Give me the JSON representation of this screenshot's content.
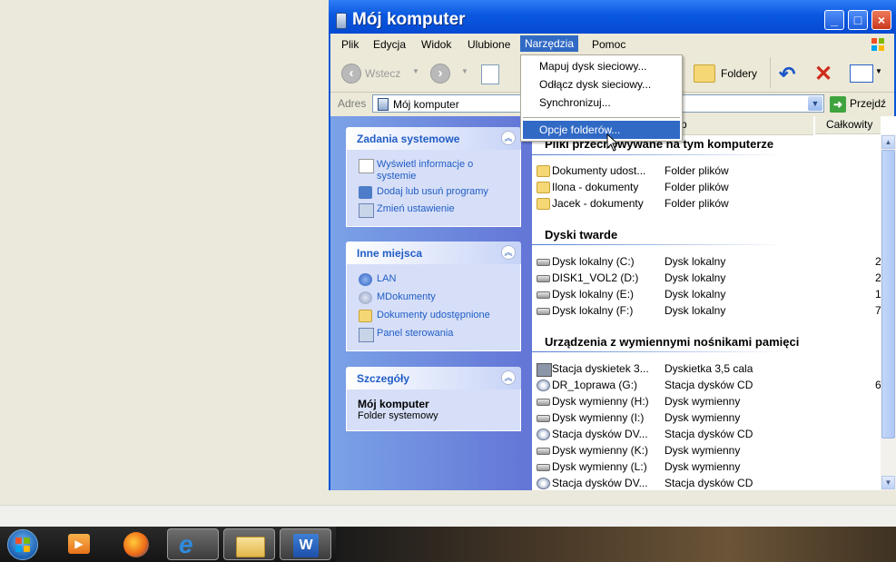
{
  "window": {
    "title": "Mój komputer",
    "min": "_",
    "max": "□",
    "close": "×"
  },
  "menu": [
    "Plik",
    "Edycja",
    "Widok",
    "Ulubione",
    "Narzędzia",
    "Pomoc"
  ],
  "toolbar": {
    "back": "Wstecz",
    "folders": "Foldery"
  },
  "address": {
    "label": "Adres",
    "value": "Mój komputer",
    "go": "Przejdź"
  },
  "dropdown": {
    "items": [
      "Mapuj dysk sieciowy...",
      "Odłącz dysk sieciowy...",
      "Synchronizuj...",
      "Opcje folderów..."
    ]
  },
  "tasks": {
    "system": {
      "title": "Zadania systemowe",
      "items": [
        "Wyświetl informacje o systemie",
        "Dodaj lub usuń programy",
        "Zmień ustawienie"
      ]
    },
    "places": {
      "title": "Inne miejsca",
      "items": [
        "LAN",
        "MDokumenty",
        "Dokumenty udostępnione",
        "Panel sterowania"
      ]
    },
    "details": {
      "title": "Szczegóły",
      "name": "Mój komputer",
      "desc": "Folder systemowy"
    }
  },
  "columns": {
    "type_suffix": "p",
    "total": "Całkowity"
  },
  "groups": {
    "shared": {
      "title": "Pliki przechowywane na tym komputerze",
      "rows": [
        {
          "name": "Dokumenty udost...",
          "type": "Folder plików"
        },
        {
          "name": "Ilona - dokumenty",
          "type": "Folder plików"
        },
        {
          "name": "Jacek - dokumenty",
          "type": "Folder plików"
        }
      ]
    },
    "hdd": {
      "title": "Dyski twarde",
      "rows": [
        {
          "name": "Dysk lokalny (C:)",
          "type": "Dysk lokalny",
          "total": "2"
        },
        {
          "name": "DISK1_VOL2 (D:)",
          "type": "Dysk lokalny",
          "total": "2"
        },
        {
          "name": "Dysk lokalny (E:)",
          "type": "Dysk lokalny",
          "total": "1"
        },
        {
          "name": "Dysk lokalny (F:)",
          "type": "Dysk lokalny",
          "total": "7"
        }
      ]
    },
    "removable": {
      "title": "Urządzenia z wymiennymi nośnikami pamięci",
      "rows": [
        {
          "name": "Stacja dyskietek 3...",
          "type": "Dyskietka 3,5 cala"
        },
        {
          "name": "DR_1oprawa (G:)",
          "type": "Stacja dysków CD",
          "total": "6"
        },
        {
          "name": "Dysk wymienny (H:)",
          "type": "Dysk wymienny"
        },
        {
          "name": "Dysk wymienny (I:)",
          "type": "Dysk wymienny"
        },
        {
          "name": "Stacja dysków DV...",
          "type": "Stacja dysków CD"
        },
        {
          "name": "Dysk wymienny (K:)",
          "type": "Dysk wymienny"
        },
        {
          "name": "Dysk wymienny (L:)",
          "type": "Dysk wymienny"
        },
        {
          "name": "Stacja dysków DV...",
          "type": "Stacja dysków CD"
        }
      ]
    }
  },
  "taskbar": {
    "items": [
      "start-orb",
      "media-player",
      "firefox",
      "internet-explorer",
      "windows-explorer",
      "word"
    ]
  }
}
